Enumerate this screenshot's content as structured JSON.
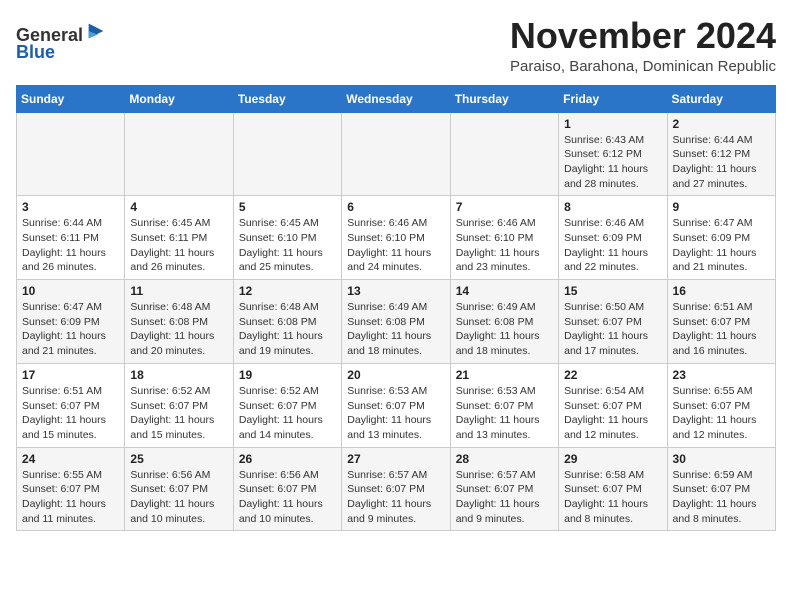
{
  "header": {
    "logo_general": "General",
    "logo_blue": "Blue",
    "month": "November 2024",
    "location": "Paraiso, Barahona, Dominican Republic"
  },
  "calendar": {
    "days_of_week": [
      "Sunday",
      "Monday",
      "Tuesday",
      "Wednesday",
      "Thursday",
      "Friday",
      "Saturday"
    ],
    "weeks": [
      [
        {
          "day": "",
          "info": ""
        },
        {
          "day": "",
          "info": ""
        },
        {
          "day": "",
          "info": ""
        },
        {
          "day": "",
          "info": ""
        },
        {
          "day": "",
          "info": ""
        },
        {
          "day": "1",
          "info": "Sunrise: 6:43 AM\nSunset: 6:12 PM\nDaylight: 11 hours\nand 28 minutes."
        },
        {
          "day": "2",
          "info": "Sunrise: 6:44 AM\nSunset: 6:12 PM\nDaylight: 11 hours\nand 27 minutes."
        }
      ],
      [
        {
          "day": "3",
          "info": "Sunrise: 6:44 AM\nSunset: 6:11 PM\nDaylight: 11 hours\nand 26 minutes."
        },
        {
          "day": "4",
          "info": "Sunrise: 6:45 AM\nSunset: 6:11 PM\nDaylight: 11 hours\nand 26 minutes."
        },
        {
          "day": "5",
          "info": "Sunrise: 6:45 AM\nSunset: 6:10 PM\nDaylight: 11 hours\nand 25 minutes."
        },
        {
          "day": "6",
          "info": "Sunrise: 6:46 AM\nSunset: 6:10 PM\nDaylight: 11 hours\nand 24 minutes."
        },
        {
          "day": "7",
          "info": "Sunrise: 6:46 AM\nSunset: 6:10 PM\nDaylight: 11 hours\nand 23 minutes."
        },
        {
          "day": "8",
          "info": "Sunrise: 6:46 AM\nSunset: 6:09 PM\nDaylight: 11 hours\nand 22 minutes."
        },
        {
          "day": "9",
          "info": "Sunrise: 6:47 AM\nSunset: 6:09 PM\nDaylight: 11 hours\nand 21 minutes."
        }
      ],
      [
        {
          "day": "10",
          "info": "Sunrise: 6:47 AM\nSunset: 6:09 PM\nDaylight: 11 hours\nand 21 minutes."
        },
        {
          "day": "11",
          "info": "Sunrise: 6:48 AM\nSunset: 6:08 PM\nDaylight: 11 hours\nand 20 minutes."
        },
        {
          "day": "12",
          "info": "Sunrise: 6:48 AM\nSunset: 6:08 PM\nDaylight: 11 hours\nand 19 minutes."
        },
        {
          "day": "13",
          "info": "Sunrise: 6:49 AM\nSunset: 6:08 PM\nDaylight: 11 hours\nand 18 minutes."
        },
        {
          "day": "14",
          "info": "Sunrise: 6:49 AM\nSunset: 6:08 PM\nDaylight: 11 hours\nand 18 minutes."
        },
        {
          "day": "15",
          "info": "Sunrise: 6:50 AM\nSunset: 6:07 PM\nDaylight: 11 hours\nand 17 minutes."
        },
        {
          "day": "16",
          "info": "Sunrise: 6:51 AM\nSunset: 6:07 PM\nDaylight: 11 hours\nand 16 minutes."
        }
      ],
      [
        {
          "day": "17",
          "info": "Sunrise: 6:51 AM\nSunset: 6:07 PM\nDaylight: 11 hours\nand 15 minutes."
        },
        {
          "day": "18",
          "info": "Sunrise: 6:52 AM\nSunset: 6:07 PM\nDaylight: 11 hours\nand 15 minutes."
        },
        {
          "day": "19",
          "info": "Sunrise: 6:52 AM\nSunset: 6:07 PM\nDaylight: 11 hours\nand 14 minutes."
        },
        {
          "day": "20",
          "info": "Sunrise: 6:53 AM\nSunset: 6:07 PM\nDaylight: 11 hours\nand 13 minutes."
        },
        {
          "day": "21",
          "info": "Sunrise: 6:53 AM\nSunset: 6:07 PM\nDaylight: 11 hours\nand 13 minutes."
        },
        {
          "day": "22",
          "info": "Sunrise: 6:54 AM\nSunset: 6:07 PM\nDaylight: 11 hours\nand 12 minutes."
        },
        {
          "day": "23",
          "info": "Sunrise: 6:55 AM\nSunset: 6:07 PM\nDaylight: 11 hours\nand 12 minutes."
        }
      ],
      [
        {
          "day": "24",
          "info": "Sunrise: 6:55 AM\nSunset: 6:07 PM\nDaylight: 11 hours\nand 11 minutes."
        },
        {
          "day": "25",
          "info": "Sunrise: 6:56 AM\nSunset: 6:07 PM\nDaylight: 11 hours\nand 10 minutes."
        },
        {
          "day": "26",
          "info": "Sunrise: 6:56 AM\nSunset: 6:07 PM\nDaylight: 11 hours\nand 10 minutes."
        },
        {
          "day": "27",
          "info": "Sunrise: 6:57 AM\nSunset: 6:07 PM\nDaylight: 11 hours\nand 9 minutes."
        },
        {
          "day": "28",
          "info": "Sunrise: 6:57 AM\nSunset: 6:07 PM\nDaylight: 11 hours\nand 9 minutes."
        },
        {
          "day": "29",
          "info": "Sunrise: 6:58 AM\nSunset: 6:07 PM\nDaylight: 11 hours\nand 8 minutes."
        },
        {
          "day": "30",
          "info": "Sunrise: 6:59 AM\nSunset: 6:07 PM\nDaylight: 11 hours\nand 8 minutes."
        }
      ]
    ]
  }
}
